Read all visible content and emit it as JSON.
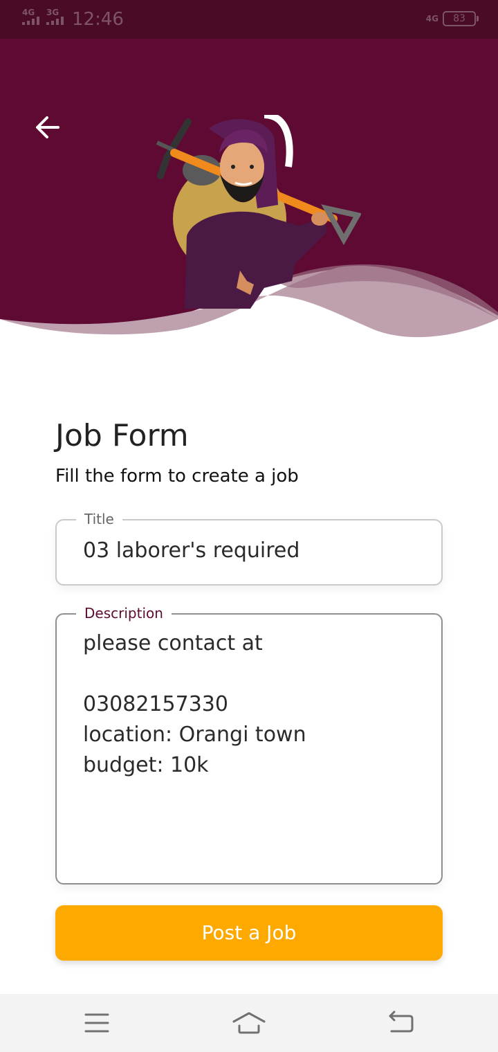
{
  "status_bar": {
    "network_1": "4G",
    "network_2": "3G",
    "time": "12:46",
    "network_right": "4G",
    "battery": "83"
  },
  "colors": {
    "header_bg": "#5e0a32",
    "status_bg": "#4a0b27",
    "accent_button": "#fea900",
    "label_focus": "#5e0a32"
  },
  "header": {
    "back_icon": "arrow-left-icon",
    "illustration": "laborer-with-shovel-illustration"
  },
  "form": {
    "title": "Job Form",
    "subtitle": "Fill the form to create a job",
    "title_field": {
      "label": "Title",
      "value": "03 laborer's required"
    },
    "description_field": {
      "label": "Description",
      "value": "please contact at\n\n03082157330\nlocation: Orangi town\nbudget: 10k"
    },
    "submit_label": "Post a Job"
  },
  "nav_bar": {
    "menu_icon": "menu-icon",
    "home_icon": "home-icon",
    "back_icon": "return-icon"
  }
}
